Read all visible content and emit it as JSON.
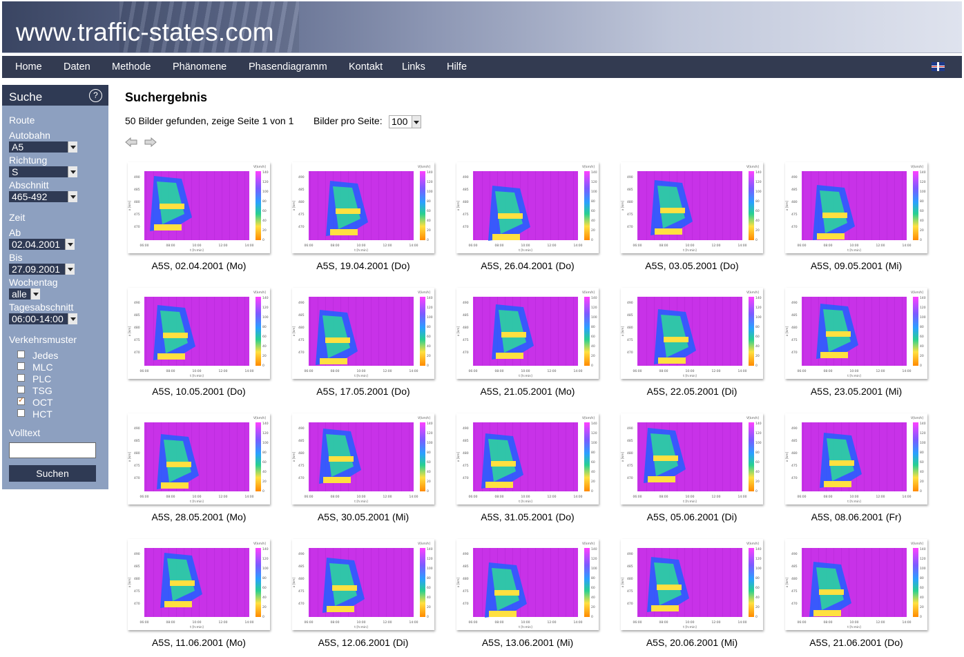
{
  "site": {
    "title": "www.traffic-states.com"
  },
  "nav": {
    "items": [
      "Home",
      "Daten",
      "Methode",
      "Phänomene",
      "Phasendiagramm",
      "Kontakt",
      "Links",
      "Hilfe"
    ],
    "flag_icon": "uk-flag-icon"
  },
  "sidebar": {
    "title": "Suche",
    "help_label": "?",
    "route_heading": "Route",
    "autobahn_label": "Autobahn",
    "autobahn_value": "A5",
    "richtung_label": "Richtung",
    "richtung_value": "S",
    "abschnitt_label": "Abschnitt",
    "abschnitt_value": "465-492",
    "zeit_heading": "Zeit",
    "ab_label": "Ab",
    "ab_value": "02.04.2001",
    "bis_label": "Bis",
    "bis_value": "27.09.2001",
    "wochentag_label": "Wochentag",
    "wochentag_value": "alle",
    "tagesabschnitt_label": "Tagesabschnitt",
    "tagesabschnitt_value": "06:00-14:00",
    "verkehrsmuster_heading": "Verkehrsmuster",
    "patterns": [
      {
        "label": "Jedes",
        "checked": false
      },
      {
        "label": "MLC",
        "checked": false
      },
      {
        "label": "PLC",
        "checked": false
      },
      {
        "label": "TSG",
        "checked": false
      },
      {
        "label": "OCT",
        "checked": true
      },
      {
        "label": "HCT",
        "checked": false
      }
    ],
    "volltext_label": "Volltext",
    "volltext_value": "",
    "search_button": "Suchen"
  },
  "main": {
    "heading": "Suchergebnis",
    "found_text": "50 Bilder gefunden, zeige Seite 1 von 1",
    "per_page_label": "Bilder pro Seite:",
    "per_page_value": "100",
    "prev_icon": "arrow-left-icon",
    "next_icon": "arrow-right-icon"
  },
  "results": [
    "A5S, 02.04.2001 (Mo)",
    "A5S, 19.04.2001 (Do)",
    "A5S, 26.04.2001 (Do)",
    "A5S, 03.05.2001 (Do)",
    "A5S, 09.05.2001 (Mi)",
    "A5S, 10.05.2001 (Do)",
    "A5S, 17.05.2001 (Do)",
    "A5S, 21.05.2001 (Mo)",
    "A5S, 22.05.2001 (Di)",
    "A5S, 23.05.2001 (Mi)",
    "A5S, 28.05.2001 (Mo)",
    "A5S, 30.05.2001 (Mi)",
    "A5S, 31.05.2001 (Do)",
    "A5S, 05.06.2001 (Di)",
    "A5S, 08.06.2001 (Fr)",
    "A5S, 11.06.2001 (Mo)",
    "A5S, 12.06.2001 (Di)",
    "A5S, 13.06.2001 (Mi)",
    "A5S, 20.06.2001 (Mi)",
    "A5S, 21.06.2001 (Do)"
  ],
  "thumb_axes": {
    "unit_label": "V[km/h]",
    "scale_ticks": [
      "140",
      "120",
      "100",
      "80",
      "60",
      "40",
      "20",
      "0"
    ],
    "y_axis_label": "x [km]",
    "y_ticks": [
      "490",
      "485",
      "480",
      "475",
      "470"
    ],
    "x_axis_label": "t [h:min]",
    "x_ticks": [
      "06:00",
      "08:00",
      "10:00",
      "12:00",
      "14:00"
    ]
  },
  "colors": {
    "header_dark": "#333b51",
    "sidebar_bg": "#8da0c0",
    "plot_free_flow": "#c832e8",
    "plot_congested": "#ffe040"
  }
}
